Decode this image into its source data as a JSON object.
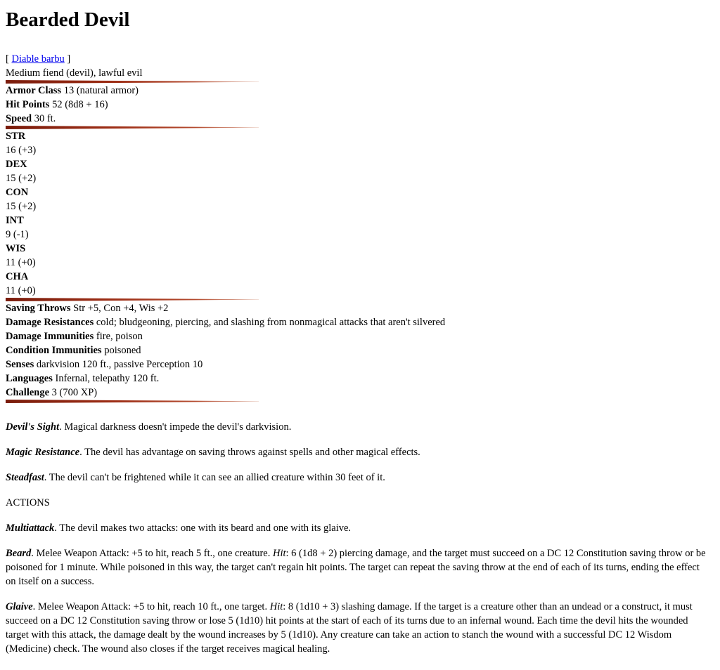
{
  "title": "Bearded Devil",
  "translation": {
    "open": "[ ",
    "link": "Diable barbu",
    "close": " ]"
  },
  "type_line": "Medium fiend (devil), lawful evil",
  "basic_stats": [
    {
      "label": "Armor Class",
      "value": " 13 (natural armor)"
    },
    {
      "label": "Hit Points",
      "value": " 52 (8d8 + 16)"
    },
    {
      "label": "Speed",
      "value": " 30 ft."
    }
  ],
  "abilities": [
    {
      "name": "STR",
      "score": "16 (+3)"
    },
    {
      "name": "DEX",
      "score": "15 (+2)"
    },
    {
      "name": "CON",
      "score": "15 (+2)"
    },
    {
      "name": "INT",
      "score": "9 (-1)"
    },
    {
      "name": "WIS",
      "score": "11 (+0)"
    },
    {
      "name": "CHA",
      "score": "11 (+0)"
    }
  ],
  "properties": [
    {
      "label": "Saving Throws",
      "value": " Str +5, Con +4, Wis +2"
    },
    {
      "label": "Damage Resistances",
      "value": " cold; bludgeoning, piercing, and slashing from nonmagical attacks that aren't silvered"
    },
    {
      "label": "Damage Immunities",
      "value": " fire, poison"
    },
    {
      "label": "Condition Immunities",
      "value": " poisoned"
    },
    {
      "label": "Senses",
      "value": " darkvision 120 ft., passive Perception 10"
    },
    {
      "label": "Languages",
      "value": " Infernal, telepathy 120 ft."
    },
    {
      "label": "Challenge",
      "value": " 3 (700 XP)"
    }
  ],
  "traits": [
    {
      "name": "Devil's Sight",
      "text": ". Magical darkness doesn't impede the devil's darkvision."
    },
    {
      "name": "Magic Resistance",
      "text": ". The devil has advantage on saving throws against spells and other magical effects."
    },
    {
      "name": "Steadfast",
      "text": ". The devil can't be frightened while it can see an allied creature within 30 feet of it."
    }
  ],
  "actions_heading": "ACTIONS",
  "actions": [
    {
      "name": "Multiattack",
      "pre": ". The devil makes two attacks: one with its beard and one with its glaive.",
      "hit_label": "",
      "post": ""
    },
    {
      "name": "Beard",
      "pre": ". Melee Weapon Attack: +5 to hit, reach 5 ft., one creature. ",
      "hit_label": "Hit",
      "post": ": 6 (1d8 + 2) piercing damage, and the target must succeed on a DC 12 Constitution saving throw or be poisoned for 1 minute. While poisoned in this way, the target can't regain hit points. The target can repeat the saving throw at the end of each of its turns, ending the effect on itself on a success."
    },
    {
      "name": "Glaive",
      "pre": ". Melee Weapon Attack: +5 to hit, reach 10 ft., one target. ",
      "hit_label": "Hit",
      "post": ": 8 (1d10 + 3) slashing damage. If the target is a creature other than an undead or a construct, it must succeed on a DC 12 Constitution saving throw or lose 5 (1d10) hit points at the start of each of its turns due to an infernal wound. Each time the devil hits the wounded target with this attack, the damage dealt by the wound increases by 5 (1d10). Any creature can take an action to stanch the wound with a successful DC 12 Wisdom (Medicine) check. The wound also closes if the target receives magical healing."
    }
  ],
  "rule_colors": {
    "dark": "#7a1c0c",
    "light": "#e6c2b4"
  }
}
